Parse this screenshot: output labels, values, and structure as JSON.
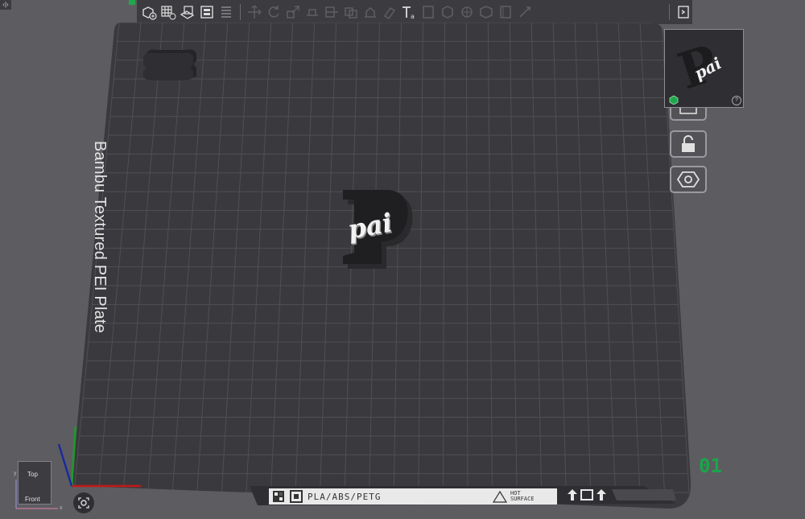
{
  "corner_tag": "‹|›",
  "toolbar": {
    "icons": [
      "add-object-icon",
      "add-plate-icon",
      "auto-orient-icon",
      "arrange-icon",
      "split-icon",
      "move-icon",
      "rotate-icon",
      "scale-icon",
      "lay-flat-icon",
      "cut-icon",
      "boolean-icon",
      "support-paint-icon",
      "seam-paint-icon",
      "text-icon",
      "measure-icon",
      "assembly-icon",
      "variable-layer-icon",
      "mesh-boolean-icon",
      "color-paint-icon",
      "brim-ears-icon"
    ],
    "right_icon": "slice-view-icon"
  },
  "plate": {
    "label": "Bambu Textured PEI Plate",
    "number": "01",
    "object_text": "pai",
    "object_letter": "P",
    "filament_text": "PLA/ABS/PETG",
    "hot_surface_text": "HOT\nSURFACE"
  },
  "preview": {
    "letter": "P",
    "text": "pai",
    "help": "?"
  },
  "side_tools": [
    "orient-icon",
    "arrange-icon",
    "lock-icon",
    "settings-icon"
  ],
  "view_cube": {
    "top": "Top",
    "front": "Front"
  },
  "axes": {
    "x": "x",
    "y": "y"
  },
  "colors": {
    "accent_green": "#19a64a",
    "plate_dark": "#3a3a3e",
    "grid": "#4f4f54"
  }
}
